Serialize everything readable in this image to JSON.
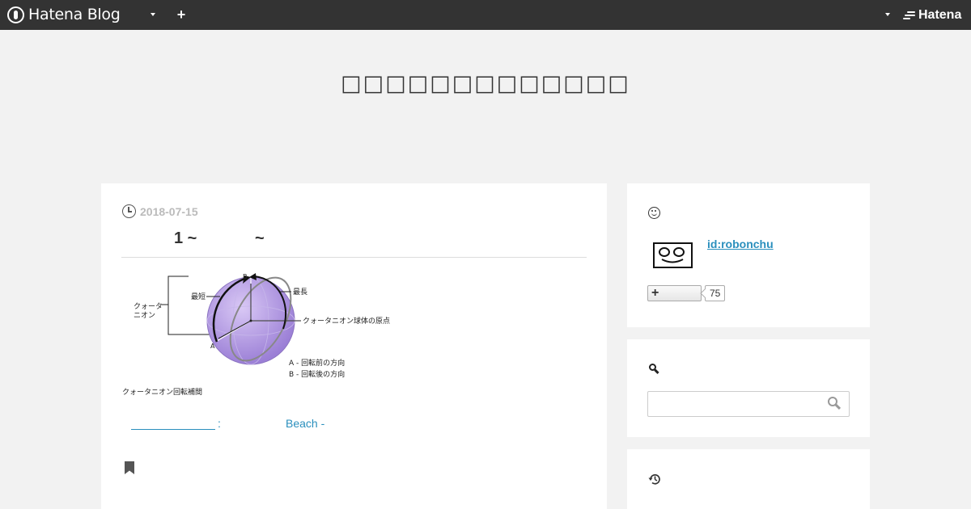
{
  "topbar": {
    "brand_label": "Hatena Blog",
    "brand_icon": "hatena-blog-logo-icon",
    "menu_caret_icon": "caret-down-icon",
    "add_icon": "plus-icon",
    "add_label": "+",
    "right_caret_icon": "caret-down-icon",
    "hatena_label": "Hatena",
    "hatena_icon": "hatena-logo-icon"
  },
  "blog": {
    "title": "□□□□□□□□□□□□□"
  },
  "entry": {
    "date": "2018-07-15",
    "date_icon": "clock-icon",
    "title_part1": "1 ~",
    "title_part2": "~",
    "figure": {
      "label_quaternion": "クォータ\nニオン",
      "label_shortest": "最短",
      "label_longest": "最長",
      "label_origin": "クォータニオン球体の原点",
      "point_a": "A",
      "point_b": "B",
      "legend_a": "A - 回転前の方向",
      "legend_b": "B - 回転後の方向",
      "caption": "クォータニオン回転補間"
    },
    "link_colon": ":",
    "link_beach": "Beach -",
    "bookmark_icon": "bookmark-icon"
  },
  "sidebar": {
    "profile": {
      "header_icon": "smile-icon",
      "user_id": "id:robonchu",
      "follow_label": "+",
      "follower_count": "75"
    },
    "search": {
      "header_icon": "search-icon",
      "placeholder": "",
      "submit_icon": "search-icon"
    },
    "recent": {
      "header_icon": "history-icon"
    }
  }
}
